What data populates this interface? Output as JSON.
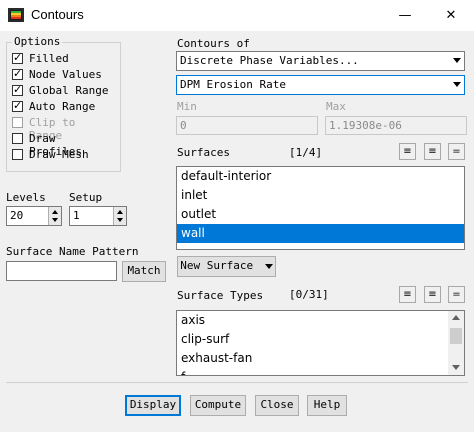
{
  "window": {
    "title": "Contours",
    "controls": {
      "minimize": "—",
      "close": "✕"
    }
  },
  "options": {
    "legend": "Options",
    "items": [
      {
        "label": "Filled",
        "checked": true,
        "disabled": false
      },
      {
        "label": "Node Values",
        "checked": true,
        "disabled": false
      },
      {
        "label": "Global Range",
        "checked": true,
        "disabled": false
      },
      {
        "label": "Auto Range",
        "checked": true,
        "disabled": false
      },
      {
        "label": "Clip to Range",
        "checked": false,
        "disabled": true
      },
      {
        "label": "Draw Profiles",
        "checked": false,
        "disabled": false
      },
      {
        "label": "Draw Mesh",
        "checked": false,
        "disabled": false
      }
    ]
  },
  "levels": {
    "label": "Levels",
    "value": "20"
  },
  "setup": {
    "label": "Setup",
    "value": "1"
  },
  "surface_name_pattern": {
    "label": "Surface Name Pattern",
    "value": "",
    "match_button": "Match"
  },
  "contours_of": {
    "label": "Contours of",
    "category": "Discrete Phase Variables...",
    "variable": "DPM Erosion Rate"
  },
  "range": {
    "min_label": "Min",
    "min_value": "0",
    "max_label": "Max",
    "max_value": "1.19308e-06"
  },
  "surfaces": {
    "label": "Surfaces",
    "count": "[1/4]",
    "items": [
      "default-interior",
      "inlet",
      "outlet",
      "wall"
    ],
    "selected_index": 3,
    "new_surface_button": "New Surface"
  },
  "surface_types": {
    "label": "Surface Types",
    "count": "[0/31]",
    "items": [
      "axis",
      "clip-surf",
      "exhaust-fan",
      "f"
    ]
  },
  "buttons": {
    "display": "Display",
    "compute": "Compute",
    "close": "Close",
    "help": "Help"
  },
  "colors": {
    "selection": "#0078d7",
    "default_button_border": "#0078d7"
  }
}
